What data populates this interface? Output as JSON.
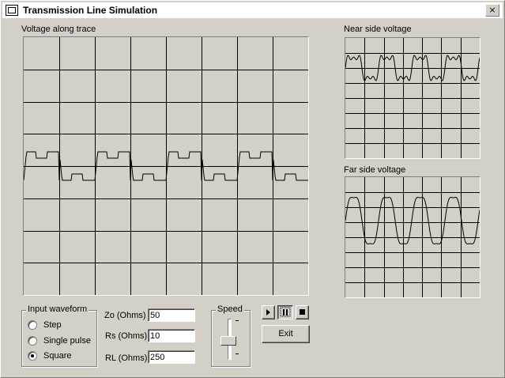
{
  "window": {
    "title": "Transmission Line Simulation",
    "close_glyph": "×"
  },
  "plots": {
    "main": {
      "label": "Voltage along trace"
    },
    "near": {
      "label": "Near side voltage"
    },
    "far": {
      "label": "Far side voltage"
    }
  },
  "input_waveform": {
    "label": "Input waveform",
    "options": [
      {
        "label": "Step",
        "selected": false
      },
      {
        "label": "Single pulse",
        "selected": false
      },
      {
        "label": "Square",
        "selected": true
      }
    ]
  },
  "fields": [
    {
      "label": "Zo (Ohms)",
      "value": "50"
    },
    {
      "label": "Rs (Ohms)",
      "value": "10"
    },
    {
      "label": "RL (Ohms)",
      "value": "250"
    }
  ],
  "speed": {
    "label": "Speed",
    "level": 0.55
  },
  "controls": {
    "play_icon": "play-icon",
    "pause_icon": "pause-icon",
    "stop_icon": "stop-icon",
    "exit_label": "Exit"
  }
}
